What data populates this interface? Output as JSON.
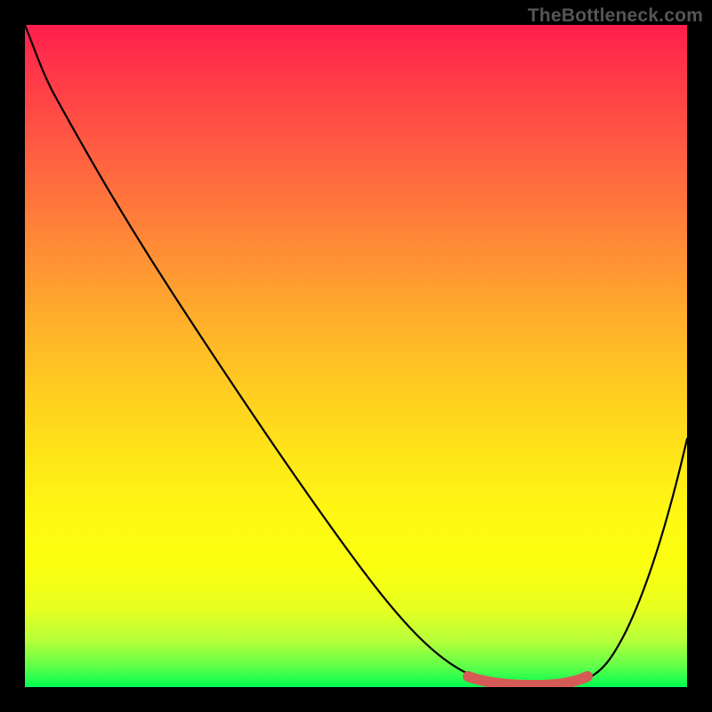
{
  "watermark": "TheBottleneck.com",
  "colors": {
    "background": "#000000",
    "gradient_top": "#ff1e4c",
    "gradient_bottom": "#00ff50",
    "curve": "#000000",
    "flat_marker": "#d65a56"
  },
  "chart_data": {
    "type": "line",
    "title": "",
    "xlabel": "",
    "ylabel": "",
    "xlim": [
      0,
      100
    ],
    "ylim": [
      0,
      100
    ],
    "axes_visible": false,
    "grid": false,
    "background_gradient": "vertical red→yellow→green",
    "series": [
      {
        "name": "bottleneck-curve",
        "x": [
          0,
          3,
          8,
          14,
          22,
          30,
          38,
          46,
          54,
          60,
          65,
          70,
          74,
          78,
          82,
          86,
          90,
          95,
          100
        ],
        "y": [
          100,
          97,
          92,
          85,
          75,
          64,
          53,
          42,
          30,
          20,
          12,
          6,
          2,
          1,
          1,
          2,
          10,
          25,
          45
        ],
        "note": "V-shaped curve dropping from upper-left to a flat minimum near x≈74–84, then rising steeply"
      }
    ],
    "annotations": [
      {
        "name": "optimal-flat-region",
        "x_range": [
          70,
          86
        ],
        "y": 1,
        "style": "thick salmon segment marking the minimum"
      }
    ]
  }
}
